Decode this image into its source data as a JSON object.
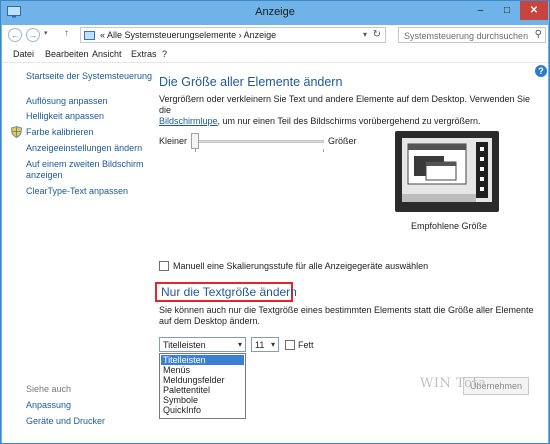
{
  "window": {
    "title": "Anzeige",
    "minimize": "–",
    "maximize": "□",
    "close": "✕"
  },
  "nav": {
    "back": "←",
    "forward": "→",
    "history": "▾",
    "up": "↑",
    "address": {
      "prefix": "«",
      "path1": "Alle Systemsteuerungselemente",
      "sep": "›",
      "path2": "Anzeige",
      "dropdown": "▾",
      "refresh": "↻"
    },
    "search_placeholder": "Systemsteuerung durchsuchen",
    "search_icon": "⚲"
  },
  "menu": [
    "Datei",
    "Bearbeiten",
    "Ansicht",
    "Extras",
    "?"
  ],
  "sidebar": {
    "home": "Startseite der Systemsteuerung",
    "links": [
      "Auflösung anpassen",
      "Helligkeit anpassen",
      "Farbe kalibrieren",
      "Anzeigeeinstellungen ändern",
      "Auf einem zweiten Bildschirm",
      "anzeigen",
      "ClearType-Text anpassen"
    ],
    "see_also_heading": "Siehe auch",
    "see_also": [
      "Anpassung",
      "Geräte und Drucker"
    ]
  },
  "main": {
    "heading": "Die Größe aller Elemente ändern",
    "desc_line1": "Vergrößern oder verkleinern Sie Text und andere Elemente auf dem Desktop. Verwenden Sie die",
    "desc_link": "Bildschirmlupe",
    "desc_line2_rest": ", um nur einen Teil des Bildschirms vorübergehend zu vergrößern.",
    "slider_min": "Kleiner",
    "slider_max": "Größer",
    "slider_value": 0,
    "preview_caption": "Empfohlene Größe",
    "manual_scaling_label": "Manuell eine Skalierungsstufe für alle Anzeigegeräte auswählen",
    "text_heading": "Nur die Textgröße ändern",
    "text_desc": "Sie können auch nur die Textgröße eines bestimmten Elements statt die Größe aller Elemente auf dem Desktop ändern.",
    "element_select": "Titelleisten",
    "size_select": "11",
    "bold_label": "Fett",
    "dropdown_options": [
      "Titelleisten",
      "Menüs",
      "Meldungsfelder",
      "Palettentitel",
      "Symbole",
      "QuickInfo"
    ],
    "apply_button": "Übernehmen",
    "watermark": "WIN Tota"
  }
}
